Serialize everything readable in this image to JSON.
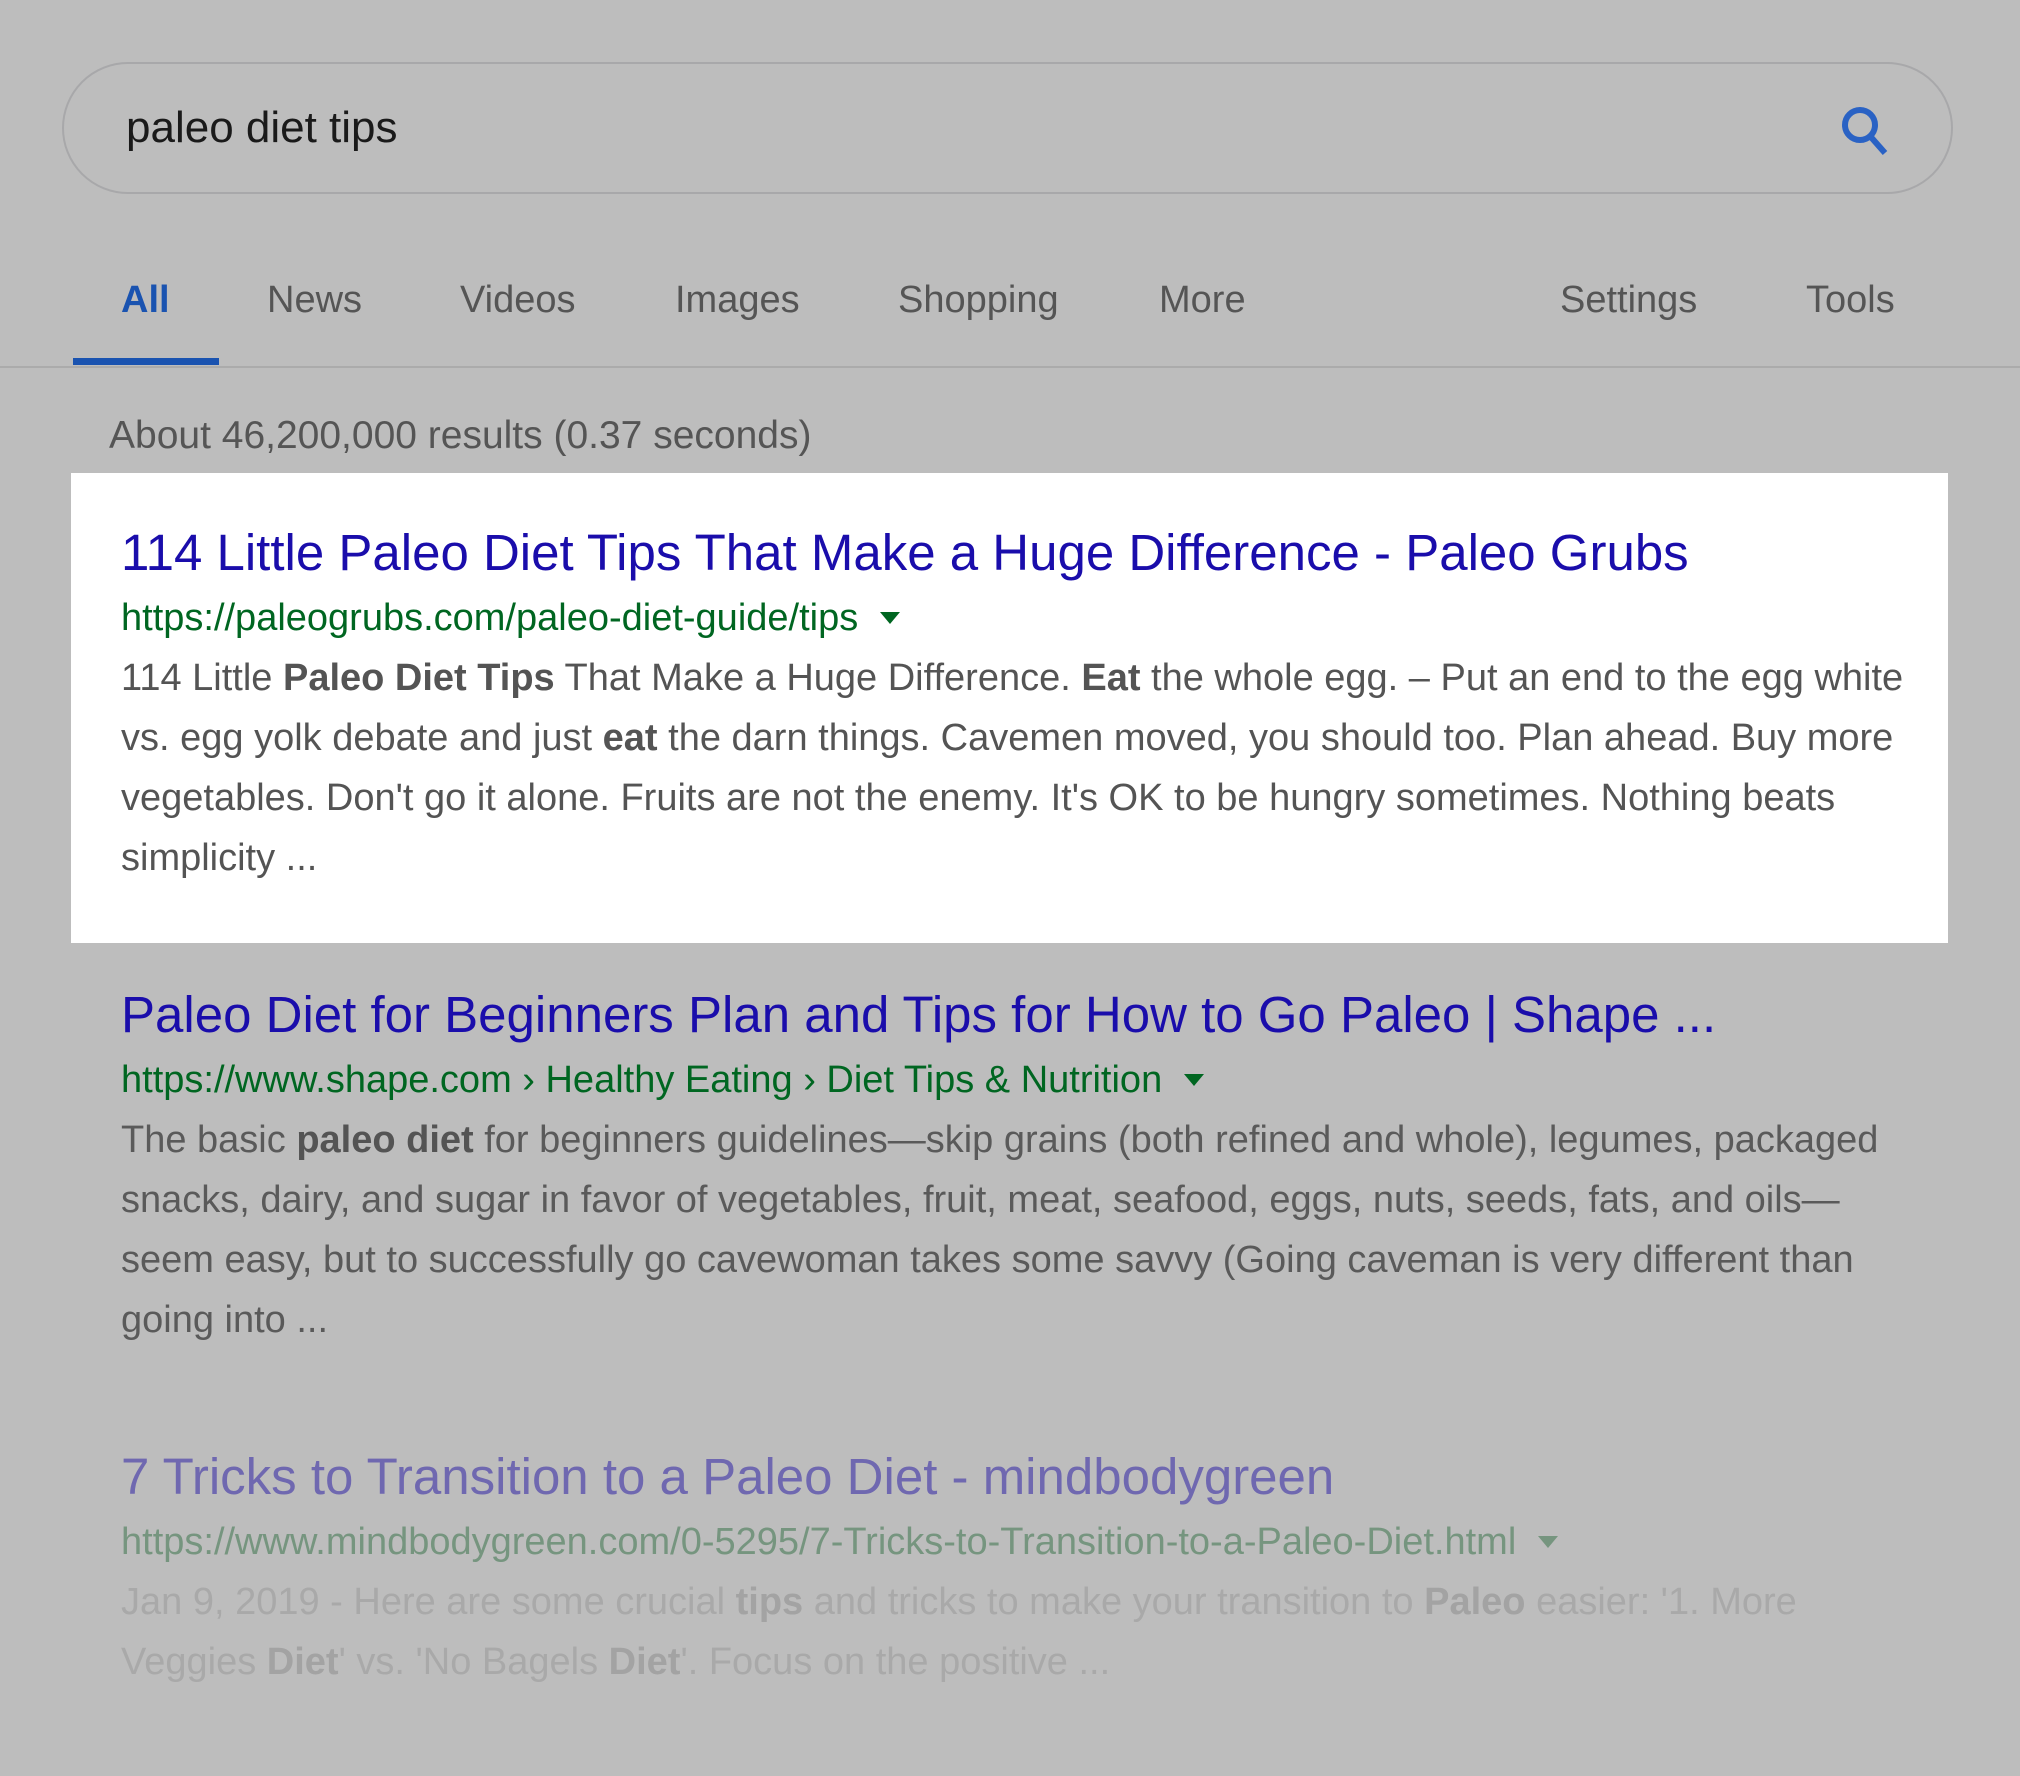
{
  "search": {
    "query": "paleo diet tips",
    "icon": "search-icon",
    "accent_color": "#1a53b0"
  },
  "tabs": [
    {
      "label": "All",
      "active": true
    },
    {
      "label": "News",
      "active": false
    },
    {
      "label": "Videos",
      "active": false
    },
    {
      "label": "Images",
      "active": false
    },
    {
      "label": "Shopping",
      "active": false
    },
    {
      "label": "More",
      "active": false
    },
    {
      "label": "Settings",
      "active": false
    },
    {
      "label": "Tools",
      "active": false
    }
  ],
  "result_stats": "About 46,200,000 results (0.37 seconds)",
  "results": [
    {
      "title": "114 Little Paleo Diet Tips That Make a Huge Difference - Paleo Grubs",
      "url": "https://paleogrubs.com/paleo-diet-guide/tips",
      "highlighted": true,
      "snippet": [
        {
          "t": "114 Little ",
          "b": false
        },
        {
          "t": "Paleo Diet Tips",
          "b": true
        },
        {
          "t": " That Make a Huge Difference. ",
          "b": false
        },
        {
          "t": "Eat",
          "b": true
        },
        {
          "t": " the whole egg. – Put an end to the egg white vs. egg yolk debate and just ",
          "b": false
        },
        {
          "t": "eat",
          "b": true
        },
        {
          "t": " the darn things. Cavemen moved, you should too. Plan ahead. Buy more vegetables. Don't go it alone. Fruits are not the enemy. It's OK to be hungry sometimes. Nothing beats simplicity ...",
          "b": false
        }
      ]
    },
    {
      "title": "Paleo Diet for Beginners Plan and Tips for How to Go Paleo | Shape ...",
      "url": "https://www.shape.com › Healthy Eating › Diet Tips & Nutrition",
      "highlighted": false,
      "snippet": [
        {
          "t": "The basic ",
          "b": false
        },
        {
          "t": "paleo diet",
          "b": true
        },
        {
          "t": " for beginners guidelines—skip grains (both refined and whole), legumes, packaged snacks, dairy, and sugar in favor of vegetables, fruit, meat, seafood, eggs, nuts, seeds, fats, and oils—seem easy, but to successfully go cavewoman takes some savvy (Going caveman is very different than going into ...",
          "b": false
        }
      ]
    },
    {
      "title": "7 Tricks to Transition to a Paleo Diet - mindbodygreen",
      "url": "https://www.mindbodygreen.com/0-5295/7-Tricks-to-Transition-to-a-Paleo-Diet.html",
      "highlighted": false,
      "snippet": [
        {
          "t": "Jan 9, 2019 - Here are some crucial ",
          "b": false
        },
        {
          "t": "tips",
          "b": true
        },
        {
          "t": " and tricks to make your transition to ",
          "b": false
        },
        {
          "t": "Paleo",
          "b": true
        },
        {
          "t": " easier: '1. More Veggies ",
          "b": false
        },
        {
          "t": "Diet",
          "b": true
        },
        {
          "t": "' vs. 'No Bagels ",
          "b": false
        },
        {
          "t": "Diet",
          "b": true
        },
        {
          "t": "'. Focus on the positive ...",
          "b": false
        }
      ]
    }
  ],
  "colors": {
    "link": "#1a0dab",
    "url_green": "#006621",
    "snippet": "#545454",
    "background": "#bdbdbd"
  }
}
